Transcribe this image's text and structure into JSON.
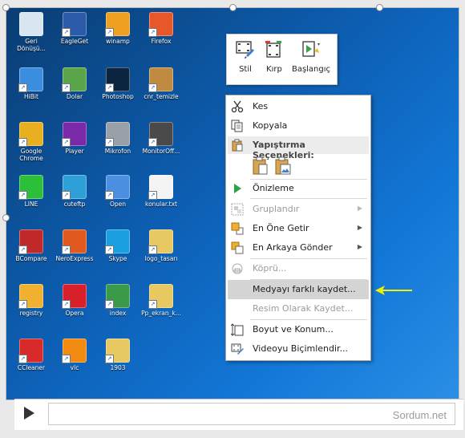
{
  "desktop": {
    "icons": [
      {
        "label": "Geri\nDönüşü...",
        "icon": "recycle-bin-icon",
        "color": "#d9e6f2"
      },
      {
        "label": "EagleGet",
        "icon": "eagle-icon",
        "color": "#2b5aa8"
      },
      {
        "label": "winamp",
        "icon": "winamp-icon",
        "color": "#f0a020"
      },
      {
        "label": "Firefox",
        "icon": "firefox-icon",
        "color": "#e8572a"
      },
      {
        "label": "HiBit",
        "icon": "hibit-icon",
        "color": "#3b8de0"
      },
      {
        "label": "Dolar",
        "icon": "money-icon",
        "color": "#5aa54a"
      },
      {
        "label": "Photoshop",
        "icon": "photoshop-icon",
        "color": "#0b2540"
      },
      {
        "label": "cnr_temizle",
        "icon": "broom-icon",
        "color": "#c08a40"
      },
      {
        "label": "Google\nChrome",
        "icon": "chrome-icon",
        "color": "#e8b020"
      },
      {
        "label": "Player",
        "icon": "player-icon",
        "color": "#7a2aa8"
      },
      {
        "label": "Mikrofon",
        "icon": "headset-icon",
        "color": "#9aa0a8"
      },
      {
        "label": "MonitorOff...",
        "icon": "monitor-icon",
        "color": "#4a4a4a"
      },
      {
        "label": "LINE",
        "icon": "line-icon",
        "color": "#2bbf3a"
      },
      {
        "label": "cuteftp",
        "icon": "cuteftp-icon",
        "color": "#2f9fd8"
      },
      {
        "label": "Open",
        "icon": "open-icon",
        "color": "#4a8fe0"
      },
      {
        "label": "konular.txt",
        "icon": "text-file-icon",
        "color": "#f4f4f4"
      },
      {
        "label": "BCompare",
        "icon": "bcompare-icon",
        "color": "#c0282a"
      },
      {
        "label": "NeroExpress",
        "icon": "nero-icon",
        "color": "#e05a20"
      },
      {
        "label": "Skype",
        "icon": "skype-icon",
        "color": "#1a9fe0"
      },
      {
        "label": "logo_tasarı",
        "icon": "folder-icon",
        "color": "#e8c860"
      },
      {
        "label": "registry",
        "icon": "registry-icon",
        "color": "#f0b030"
      },
      {
        "label": "Opera",
        "icon": "opera-icon",
        "color": "#d8202a"
      },
      {
        "label": "index",
        "icon": "globe-icon",
        "color": "#3a9a4a"
      },
      {
        "label": "Pp_ekran_k...",
        "icon": "folder-icon",
        "color": "#e8c860"
      },
      {
        "label": "CCleaner",
        "icon": "ccleaner-icon",
        "color": "#d82a2a"
      },
      {
        "label": "vlc",
        "icon": "vlc-icon",
        "color": "#f08a10"
      },
      {
        "label": "1903",
        "icon": "folder-icon",
        "color": "#e8c860"
      }
    ]
  },
  "toolbar": {
    "style_label": "Stil",
    "trim_label": "Kırp",
    "start_label": "Başlangıç"
  },
  "menu": {
    "cut": "Kes",
    "copy": "Kopyala",
    "paste_header": "Yapıştırma Seçenekleri:",
    "preview": "Önizleme",
    "group": "Gruplandır",
    "bring_front": "En Öne Getir",
    "send_back": "En Arkaya Gönder",
    "link": "Köprü...",
    "save_media": "Medyayı farklı kaydet...",
    "save_picture": "Resim Olarak Kaydet...",
    "size_position": "Boyut ve Konum...",
    "format_video": "Videoyu Biçimlendir..."
  },
  "colors": {
    "arrow": "#f2f200",
    "highlight": "#d4d4d4",
    "desktop_blue": "#0d5fb4"
  },
  "player": {
    "brand": "Sordum.net"
  }
}
